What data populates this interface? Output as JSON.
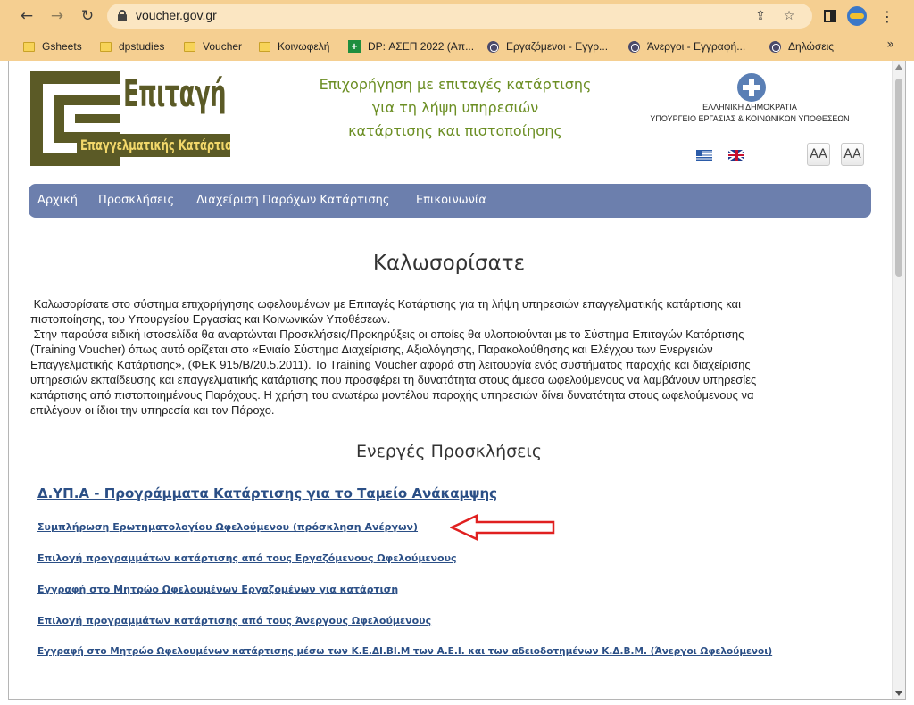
{
  "browser": {
    "url": "voucher.gov.gr",
    "bookmarks": [
      {
        "label": "Gsheets",
        "icon": "folder-icon"
      },
      {
        "label": "dpstudies",
        "icon": "folder-icon"
      },
      {
        "label": "Voucher",
        "icon": "folder-icon"
      },
      {
        "label": "Κοινωφελή",
        "icon": "folder-icon"
      },
      {
        "label": "DP: ΑΣΕΠ 2022 (Απ...",
        "icon": "plus-icon"
      },
      {
        "label": "Εργαζόμενοι - Εγγρ...",
        "icon": "globe-icon"
      },
      {
        "label": "Άνεργοι - Εγγραφή...",
        "icon": "globe-icon"
      },
      {
        "label": "Δηλώσεις",
        "icon": "globe-icon"
      }
    ],
    "more_bookmarks": "»"
  },
  "header": {
    "logo_title": "Επιταγή",
    "logo_subtitle": "Επαγγελματικής Κατάρτισης",
    "tagline_lines": [
      "Επιχορήγηση με επιταγές κατάρτισης",
      "για τη λήψη υπηρεσιών",
      "κατάρτισης και πιστοποίησης"
    ],
    "gov_line1": "ΕΛΛΗΝΙΚΗ ΔΗΜΟΚΡΑΤΙΑ",
    "gov_line2": "ΥΠΟΥΡΓΕΙΟ ΕΡΓΑΣΙΑΣ & ΚΟΙΝΩΝΙΚΩΝ ΥΠΟΘΕΣΕΩΝ",
    "font_decrease": "AA",
    "font_increase": "AA"
  },
  "nav": {
    "items": [
      "Αρχική",
      "Προσκλήσεις",
      "Διαχείριση Παρόχων Κατάρτισης",
      "Επικοινωνία"
    ]
  },
  "content": {
    "welcome_title": "Καλωσορίσατε",
    "intro_lines": [
      " Καλωσορίσατε στο σύστημα επιχορήγησης ωφελουμένων με Επιταγές Κατάρτισης για τη λήψη υπηρεσιών επαγγελματικής κατάρτισης και",
      "πιστοποίησης, του Υπουργείου Εργασίας και Κοινωνικών Υποθέσεων.",
      " Στην παρούσα ειδική ιστοσελίδα θα αναρτώνται Προσκλήσεις/Προκηρύξεις οι οποίες θα υλοποιούνται με το Σύστημα Επιταγών Κατάρτισης",
      "(Training Voucher) όπως αυτό ορίζεται στο «Ενιαίο Σύστημα Διαχείρισης, Αξιολόγησης, Παρακολούθησης και Ελέγχου των Ενεργειών",
      "Επαγγελματικής Κατάρτισης», (ΦΕΚ 915/Β/20.5.2011). Το Training Voucher αφορά στη λειτουργία ενός συστήματος παροχής και διαχείρισης",
      "υπηρεσιών εκπαίδευσης και επαγγελματικής κατάρτισης που προσφέρει τη δυνατότητα στους άμεσα ωφελούμενους να λαμβάνουν υπηρεσίες",
      "κατάρτισης από πιστοποιημένους Παρόχους. Η χρήση του ανωτέρω μοντέλου παροχής υπηρεσιών δίνει δυνατότητα στους ωφελούμενους να",
      "επιλέγουν οι ίδιοι την υπηρεσία και τον Πάροχο."
    ],
    "active_title": "Ενεργές Προσκλήσεις",
    "main_link": "Δ.ΥΠ.Α - Προγράμματα Κατάρτισης για το Ταμείο Ανάκαμψης",
    "sub_links": [
      "Συμπλήρωση Ερωτηματολογίου Ωφελούμενου (πρόσκληση Ανέργων)",
      "Επιλογή προγραμμάτων κατάρτισης από τους Εργαζόμενους Ωφελούμενους",
      "Εγγραφή στο Μητρώο Ωφελουμένων Εργαζομένων για κατάρτιση",
      "Επιλογή προγραμμάτων κατάρτισης από τους Άνεργους Ωφελούμενους",
      "Εγγραφή στο Μητρώο Ωφελουμένων κατάρτισης μέσω των Κ.Ε.ΔΙ.ΒΙ.Μ των Α.Ε.Ι. και των αδειοδοτημένων Κ.Δ.Β.Μ. (Άνεργοι Ωφελούμενοι)"
    ]
  },
  "colors": {
    "chrome": "#f5cf91",
    "nav_bar": "#6c7fad",
    "tagline": "#6b8e23",
    "link": "#2b4f86",
    "logo": "#5b5a26",
    "annotation_arrow": "#e02020"
  }
}
